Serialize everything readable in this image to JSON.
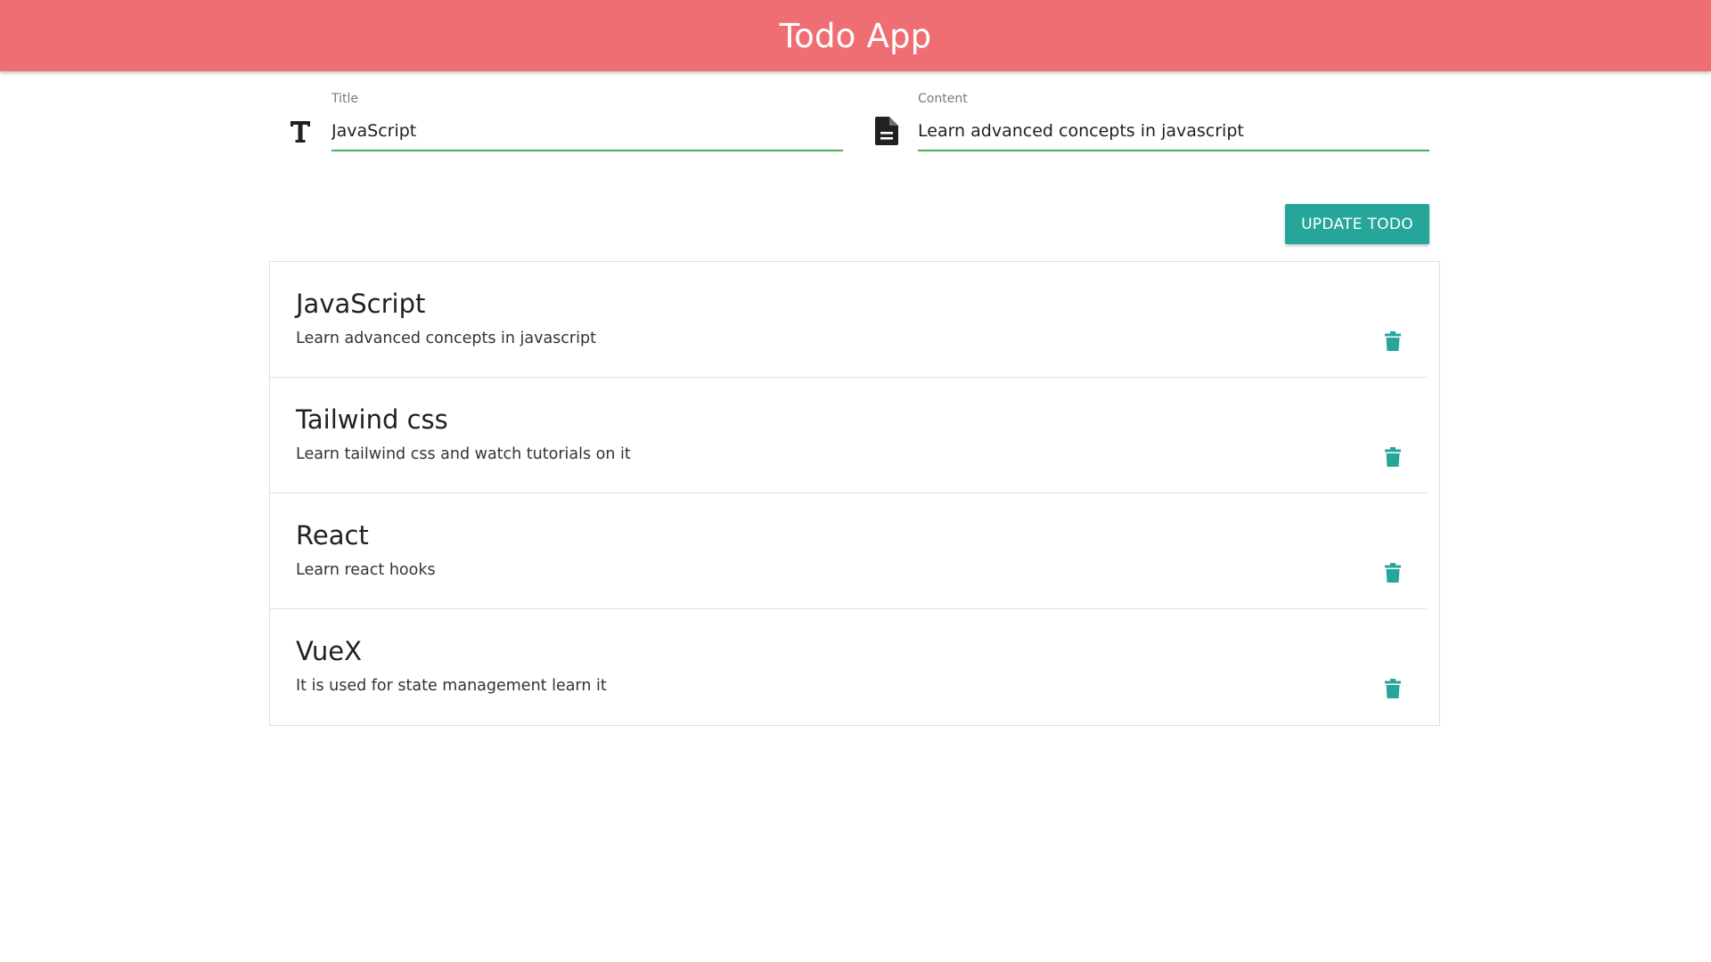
{
  "header": {
    "title": "Todo App",
    "background_color": "#ef6e73"
  },
  "form": {
    "title_field": {
      "label": "Title",
      "value": "JavaScript",
      "icon": "text-format-icon"
    },
    "content_field": {
      "label": "Content",
      "value": "Learn advanced concepts in javascript",
      "icon": "document-icon"
    },
    "underline_color": "#4caf50",
    "submit_label": "UPDATE TODO",
    "submit_color": "#26a69a"
  },
  "todos": [
    {
      "title": "JavaScript",
      "content": "Learn advanced concepts in javascript",
      "icon": "trash-icon"
    },
    {
      "title": "Tailwind css",
      "content": "Learn tailwind css and watch tutorials on it",
      "icon": "trash-icon"
    },
    {
      "title": "React",
      "content": "Learn react hooks",
      "icon": "trash-icon"
    },
    {
      "title": "VueX",
      "content": "It is used for state management learn it",
      "icon": "trash-icon"
    }
  ],
  "accent_color": "#26a69a"
}
